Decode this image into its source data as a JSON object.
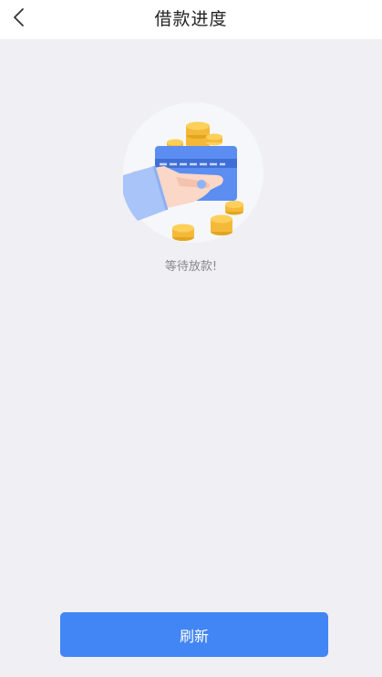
{
  "header": {
    "back_icon": "chevron-left-icon",
    "title": "借款进度"
  },
  "main": {
    "illustration": "hand-holding-card-with-coins",
    "status_text": "等待放款!"
  },
  "footer": {
    "refresh_label": "刷新"
  },
  "colors": {
    "background": "#efeff4",
    "header_bg": "#ffffff",
    "primary_button": "#4285f4",
    "coin": "#f5b93a",
    "card": "#5b8ef0"
  }
}
